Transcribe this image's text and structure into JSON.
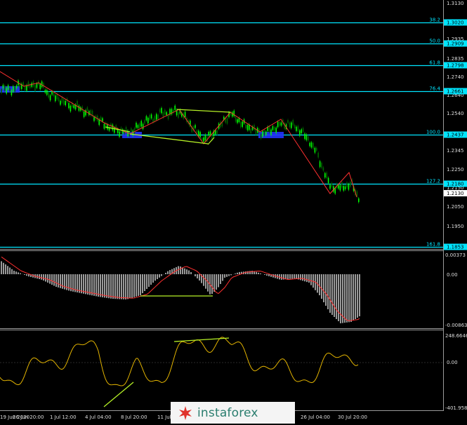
{
  "colors": {
    "background": "#000000",
    "fib_line": "#00e5ff",
    "fib_label_bg": "#00e5ff",
    "price_bull": "#00ff00",
    "price_bear": "#006400",
    "trend_line": "#ff3030",
    "divergence": "#b5f026",
    "zone": "#2233ff",
    "macd_hist": "#c0c0c0",
    "osc_line": "#e2b300",
    "axis_text": "#dddddd"
  },
  "price_axis": {
    "labels": [
      "1.3130",
      "1.3020",
      "1.2935",
      "1.2909",
      "1.2835",
      "1.2798",
      "1.2740",
      "1.2661",
      "1.2640",
      "1.2540",
      "1.2437",
      "1.2345",
      "1.2250",
      "1.2180",
      "1.2150",
      "1.2130",
      "1.2050",
      "1.1950",
      "1.1853"
    ]
  },
  "fib_levels": [
    {
      "name": "38.2",
      "price": "1.3020",
      "y": 1.302
    },
    {
      "name": "50.0",
      "price": "1.2909",
      "y": 1.2909
    },
    {
      "name": "61.8",
      "price": "1.2798",
      "y": 1.2798
    },
    {
      "name": "76.4",
      "price": "1.2661",
      "y": 1.2661
    },
    {
      "name": "100.0",
      "price": "1.2437",
      "y": 1.2437
    },
    {
      "name": "127.2",
      "price": "1.2180",
      "y": 1.218
    },
    {
      "name": "161.8",
      "price": "1.1853",
      "y": 1.1853
    }
  ],
  "current_price": "1.2130",
  "macd_axis": {
    "labels": [
      "0.00373",
      "0.00",
      "-0.00863"
    ]
  },
  "osc_axis": {
    "labels": [
      "248.6646",
      "0.00",
      "-401.958"
    ]
  },
  "time_axis": {
    "labels": [
      "19 Jun 2020",
      "26 Jun 20:00",
      "1 Jul 12:00",
      "4 Jul 04:00",
      "8 Jul 20:00",
      "11 Jul",
      "26 Jul 04:00",
      "30 Jul 20:00"
    ]
  },
  "logo": {
    "text": "instaforex"
  }
}
